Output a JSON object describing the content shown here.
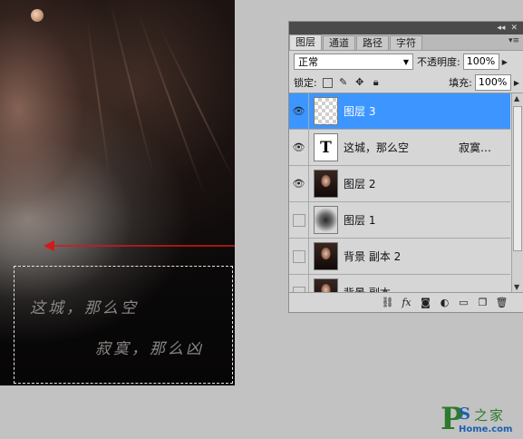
{
  "canvas": {
    "text_line1": "这城，那么空",
    "text_line2": "寂寞，那么凶"
  },
  "layers_panel": {
    "tabs": [
      {
        "label": "图层",
        "active": true
      },
      {
        "label": "通道",
        "active": false
      },
      {
        "label": "路径",
        "active": false
      },
      {
        "label": "字符",
        "active": false
      }
    ],
    "blend_mode": "正常",
    "opacity_label": "不透明度:",
    "opacity_value": "100%",
    "lock_label": "锁定:",
    "fill_label": "填充:",
    "fill_value": "100%",
    "layers": [
      {
        "name": "图层 3",
        "thumb": "checker",
        "visible": true,
        "selected": true
      },
      {
        "name": "这城，那么空",
        "extra": "寂寞…",
        "thumb": "text",
        "thumb_label": "T",
        "visible": true,
        "selected": false
      },
      {
        "name": "图层 2",
        "thumb": "photo",
        "visible": true,
        "selected": false
      },
      {
        "name": "图层 1",
        "thumb": "blur",
        "visible": false,
        "selected": false
      },
      {
        "name": "背景 副本 2",
        "thumb": "photo",
        "visible": false,
        "selected": false
      },
      {
        "name": "背景 副本",
        "thumb": "photo",
        "visible": false,
        "selected": false
      }
    ],
    "footer_icons": [
      "link-icon",
      "fx-icon",
      "mask-icon",
      "adjustment-icon",
      "group-icon",
      "new-layer-icon",
      "trash-icon"
    ]
  },
  "watermark": {
    "letter_p": "P",
    "letter_s": "S",
    "chinese": "之家",
    "url": "Home.com"
  },
  "colors": {
    "selected_layer": "#3d96ff",
    "arrow": "#d21a1a",
    "watermark_green": "#2c7a2c",
    "watermark_blue": "#1b5fb0"
  }
}
